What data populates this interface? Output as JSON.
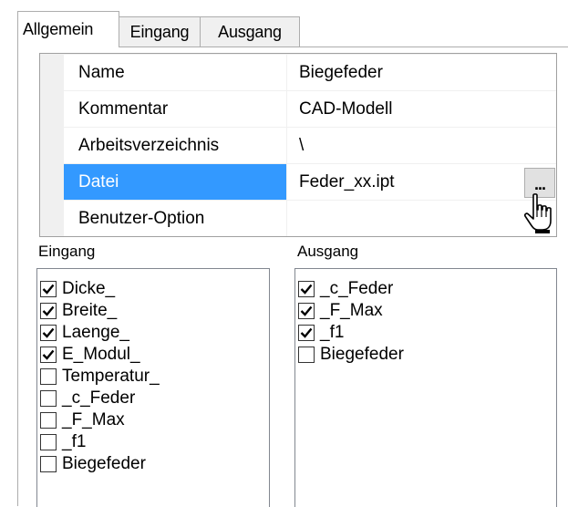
{
  "tabs": [
    {
      "label": "Allgemein",
      "active": true
    },
    {
      "label": "Eingang",
      "active": false
    },
    {
      "label": "Ausgang",
      "active": false
    }
  ],
  "properties": [
    {
      "name": "Name",
      "value": "Biegefeder",
      "selected": false
    },
    {
      "name": "Kommentar",
      "value": "CAD-Modell",
      "selected": false
    },
    {
      "name": "Arbeitsverzeichnis",
      "value": "\\",
      "selected": false
    },
    {
      "name": "Datei",
      "value": "Feder_xx.ipt",
      "selected": true,
      "button_label": "..."
    },
    {
      "name": "Benutzer-Option",
      "value": "",
      "selected": false
    }
  ],
  "colors": {
    "selection": "#3399ff",
    "grid_background": "#f0f0f0",
    "border": "#adadad"
  },
  "eingang": {
    "label": "Eingang",
    "items": [
      {
        "label": "Dicke_",
        "checked": true
      },
      {
        "label": "Breite_",
        "checked": true
      },
      {
        "label": "Laenge_",
        "checked": true
      },
      {
        "label": "E_Modul_",
        "checked": true
      },
      {
        "label": "Temperatur_",
        "checked": false
      },
      {
        "label": "_c_Feder",
        "checked": false
      },
      {
        "label": "_F_Max",
        "checked": false
      },
      {
        "label": "_f1",
        "checked": false
      },
      {
        "label": "Biegefeder",
        "checked": false
      }
    ]
  },
  "ausgang": {
    "label": "Ausgang",
    "items": [
      {
        "label": "_c_Feder",
        "checked": true
      },
      {
        "label": "_F_Max",
        "checked": true
      },
      {
        "label": "_f1",
        "checked": true
      },
      {
        "label": "Biegefeder",
        "checked": false
      }
    ]
  },
  "icons": {
    "cursor": "hand-pointer-icon",
    "check": "checkmark-icon"
  }
}
